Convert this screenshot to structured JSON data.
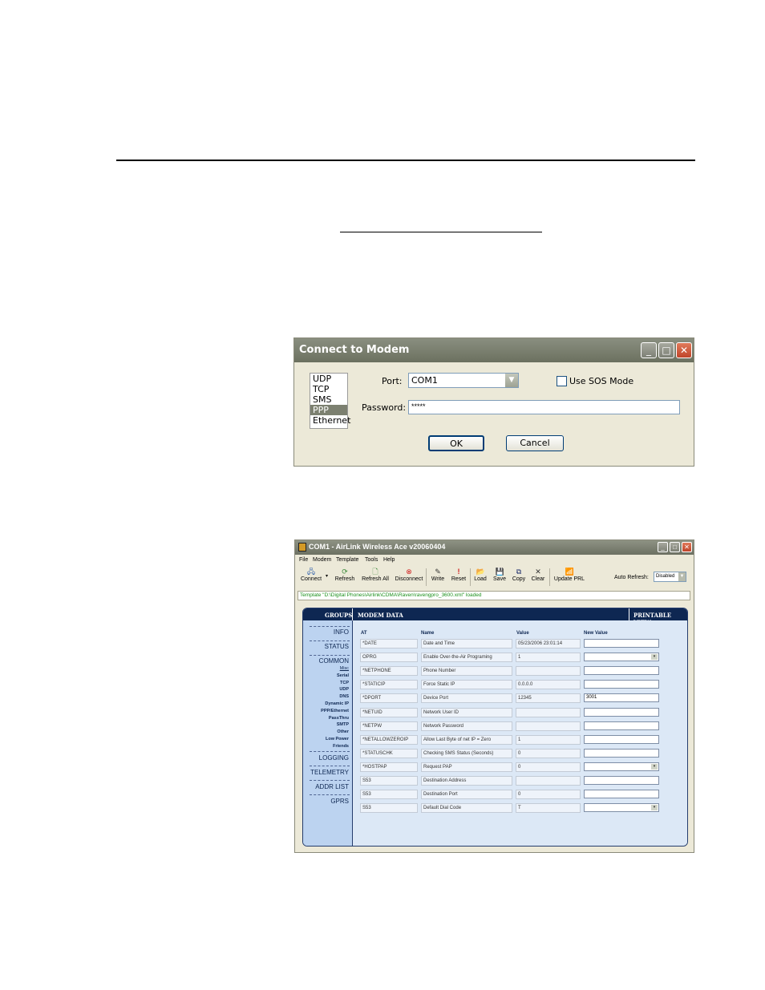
{
  "connect_dialog": {
    "title": "Connect to Modem",
    "protocols": [
      "UDP",
      "TCP",
      "SMS",
      "PPP",
      "Ethernet"
    ],
    "selected_protocol": "PPP",
    "port_label": "Port:",
    "port_value": "COM1",
    "sos_label": "Use SOS Mode",
    "password_label": "Password:",
    "password_value": "*****",
    "ok_label": "OK",
    "cancel_label": "Cancel"
  },
  "ace_window": {
    "title": "COM1 - AirLink Wireless Ace v20060404",
    "menu": [
      "File",
      "Modem",
      "Template",
      "Tools",
      "Help"
    ],
    "toolbar": [
      {
        "label": "Connect",
        "icon": "connect-icon"
      },
      {
        "label": "Refresh",
        "icon": "refresh-icon"
      },
      {
        "label": "Refresh All",
        "icon": "refresh-all-icon"
      },
      {
        "label": "Disconnect",
        "icon": "disconnect-icon"
      },
      {
        "label": "Write",
        "icon": "write-icon"
      },
      {
        "label": "Reset",
        "icon": "reset-icon"
      },
      {
        "label": "Load",
        "icon": "load-icon"
      },
      {
        "label": "Save",
        "icon": "save-icon"
      },
      {
        "label": "Copy",
        "icon": "copy-icon"
      },
      {
        "label": "Clear",
        "icon": "clear-icon"
      },
      {
        "label": "Update PRL",
        "icon": "update-prl-icon"
      }
    ],
    "auto_refresh_label": "Auto Refresh:",
    "auto_refresh_value": "Disabled",
    "template_status": "Template \"D:\\Digital Phones\\Airlink\\CDMA\\Raven\\ravengpro_3600.xml\" loaded",
    "header": {
      "groups": "GROUPS",
      "modem_data": "MODEM DATA",
      "printable_view": "PRINTABLE VIEW"
    },
    "groups": [
      "INFO",
      "STATUS",
      "COMMON",
      "LOGGING",
      "TELEMETRY",
      "ADDR LIST",
      "GPRS"
    ],
    "common_subgroups": [
      "Misc",
      "Serial",
      "TCP",
      "UDP",
      "DNS",
      "Dynamic IP",
      "PPP/Ethernet",
      "PassThru",
      "SMTP",
      "Other",
      "Low Power",
      "Friends"
    ],
    "columns": [
      "AT",
      "Name",
      "Value",
      "New Value"
    ],
    "rows": [
      {
        "at": "*DATE",
        "name": "Date and Time",
        "value": "05/23/2006 23:01:14",
        "new_value": "",
        "dropdown": false
      },
      {
        "at": "OPRG",
        "name": "Enable Over-the-Air Programing",
        "value": "1",
        "new_value": "",
        "dropdown": true
      },
      {
        "at": "*NETPHONE",
        "name": "Phone Number",
        "value": "",
        "new_value": "",
        "dropdown": false
      },
      {
        "at": "*STATICIP",
        "name": "Force Static IP",
        "value": "0.0.0.0",
        "new_value": "",
        "dropdown": false
      },
      {
        "at": "*DPORT",
        "name": "Device Port",
        "value": "12345",
        "new_value": "3001",
        "dropdown": false
      },
      {
        "at": "*NETUID",
        "name": "Network User ID",
        "value": "",
        "new_value": "",
        "dropdown": false
      },
      {
        "at": "*NETPW",
        "name": "Network Password",
        "value": "",
        "new_value": "",
        "dropdown": false
      },
      {
        "at": "*NETALLOWZEROIP",
        "name": "Allow Last Byte of net IP = Zero",
        "value": "1",
        "new_value": "",
        "dropdown": false
      },
      {
        "at": "*STATUSCHK",
        "name": "Checking SMS Status (Seconds)",
        "value": "0",
        "new_value": "",
        "dropdown": false
      },
      {
        "at": "*HOSTPAP",
        "name": "Request PAP",
        "value": "0",
        "new_value": "",
        "dropdown": true
      },
      {
        "at": "S53",
        "name": "Destination Address",
        "value": "",
        "new_value": "",
        "dropdown": false
      },
      {
        "at": "S53",
        "name": "Destination Port",
        "value": "0",
        "new_value": "",
        "dropdown": false
      },
      {
        "at": "S53",
        "name": "Default Dial Code",
        "value": "T",
        "new_value": "",
        "dropdown": true
      }
    ]
  }
}
